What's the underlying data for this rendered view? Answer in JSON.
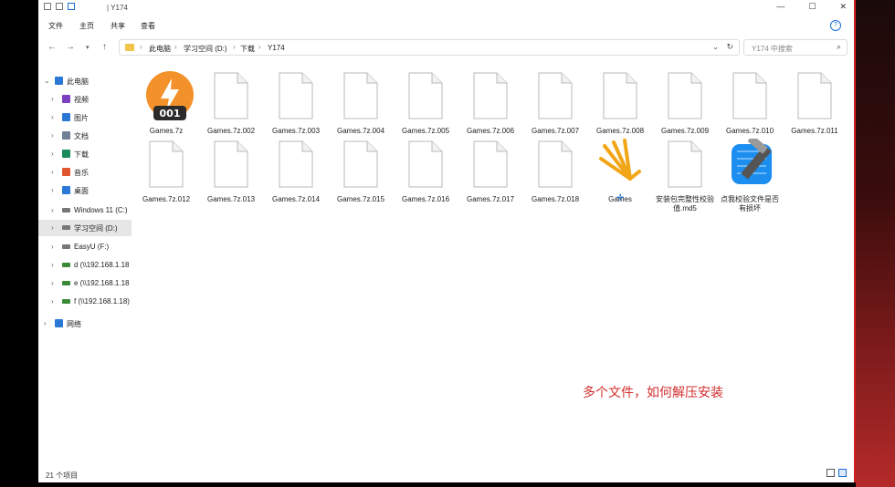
{
  "window": {
    "title": "| Y174",
    "controls": {
      "minimize": "—",
      "maximize": "☐",
      "close": "✕"
    }
  },
  "menu": {
    "file": "文件",
    "home": "主页",
    "share": "共享",
    "view": "查看",
    "help": "?"
  },
  "address": {
    "crumbs": [
      "此电脑",
      "学习空间 (D:)",
      "下载",
      "Y174"
    ],
    "separator": "›"
  },
  "search": {
    "placeholder": "Y174 中搜索"
  },
  "sidebar": {
    "items": [
      {
        "label": "此电脑",
        "icon": "computer-icon",
        "color": "#2b79d6"
      },
      {
        "label": "视频",
        "icon": "video-icon",
        "color": "#7b3fbf"
      },
      {
        "label": "图片",
        "icon": "picture-icon",
        "color": "#2b79d6"
      },
      {
        "label": "文档",
        "icon": "document-icon",
        "color": "#6f7f95"
      },
      {
        "label": "下载",
        "icon": "download-icon",
        "color": "#1a8a5a"
      },
      {
        "label": "音乐",
        "icon": "music-icon",
        "color": "#e0572f"
      },
      {
        "label": "桌面",
        "icon": "desktop-icon",
        "color": "#2b79d6"
      },
      {
        "label": "Windows 11 (C:)",
        "icon": "drive-icon",
        "color": "#777777"
      },
      {
        "label": "学习空间 (D:)",
        "icon": "drive-icon",
        "color": "#777777"
      },
      {
        "label": "EasyU (F:)",
        "icon": "drive-icon",
        "color": "#777777"
      },
      {
        "label": "d (\\\\192.168.1.18",
        "icon": "network-drive-icon",
        "color": "#3a8a3a"
      },
      {
        "label": "e (\\\\192.168.1.18",
        "icon": "network-drive-icon",
        "color": "#3a8a3a"
      },
      {
        "label": "f (\\\\192.168.1.18)",
        "icon": "network-drive-icon",
        "color": "#3a8a3a"
      },
      {
        "label": "网络",
        "icon": "network-icon",
        "color": "#2b79d6"
      }
    ]
  },
  "files": [
    {
      "name": "Games.7z",
      "type": "app001",
      "badge": "001"
    },
    {
      "name": "Games.7z.002",
      "type": "doc"
    },
    {
      "name": "Games.7z.003",
      "type": "doc"
    },
    {
      "name": "Games.7z.004",
      "type": "doc"
    },
    {
      "name": "Games.7z.005",
      "type": "doc"
    },
    {
      "name": "Games.7z.006",
      "type": "doc"
    },
    {
      "name": "Games.7z.007",
      "type": "doc"
    },
    {
      "name": "Games.7z.008",
      "type": "doc"
    },
    {
      "name": "Games.7z.009",
      "type": "doc"
    },
    {
      "name": "Games.7z.010",
      "type": "doc"
    },
    {
      "name": "Games.7z.011",
      "type": "doc"
    },
    {
      "name": "Games.7z.012",
      "type": "doc"
    },
    {
      "name": "Games.7z.013",
      "type": "doc"
    },
    {
      "name": "Games.7z.014",
      "type": "doc"
    },
    {
      "name": "Games.7z.015",
      "type": "doc"
    },
    {
      "name": "Games.7z.016",
      "type": "doc"
    },
    {
      "name": "Games.7z.017",
      "type": "doc"
    },
    {
      "name": "Games.7z.018",
      "type": "doc"
    },
    {
      "name": "Games",
      "type": "games"
    },
    {
      "name": "安装包完整性校验值.md5",
      "type": "doc"
    },
    {
      "name": "点我校验文件是否有损坏",
      "type": "xcode"
    }
  ],
  "annotation": "多个文件，如何解压安装",
  "status": {
    "count": "21 个项目"
  }
}
